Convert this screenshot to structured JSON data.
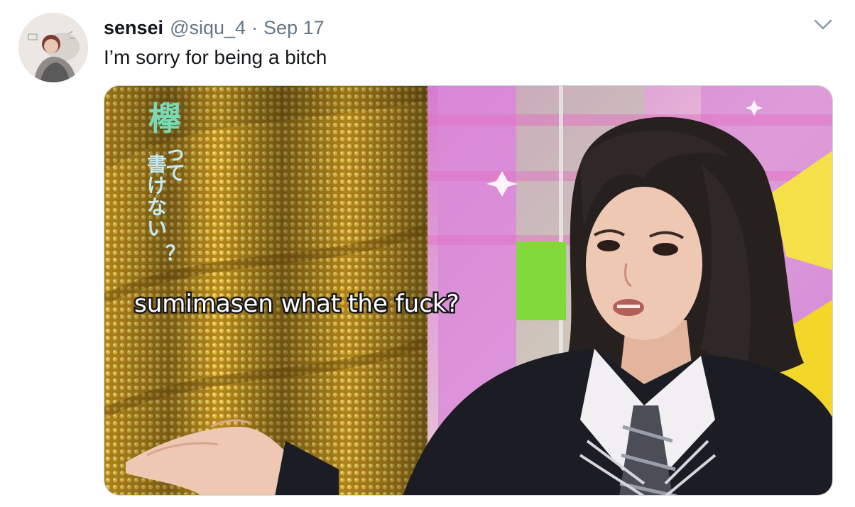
{
  "tweet": {
    "display_name": "sensei",
    "handle": "@siqu_4",
    "separator": "·",
    "date": "Sep 17",
    "text": "I’m sorry for being a bitch",
    "more_menu_icon": "chevron-down-icon"
  },
  "media": {
    "caption": "sumimasen what the fuck?",
    "overlay_vertical_text": "欅って、書けない？"
  },
  "colors": {
    "name": "#14171a",
    "secondary": "#657786",
    "border": "#ccd6dd"
  }
}
